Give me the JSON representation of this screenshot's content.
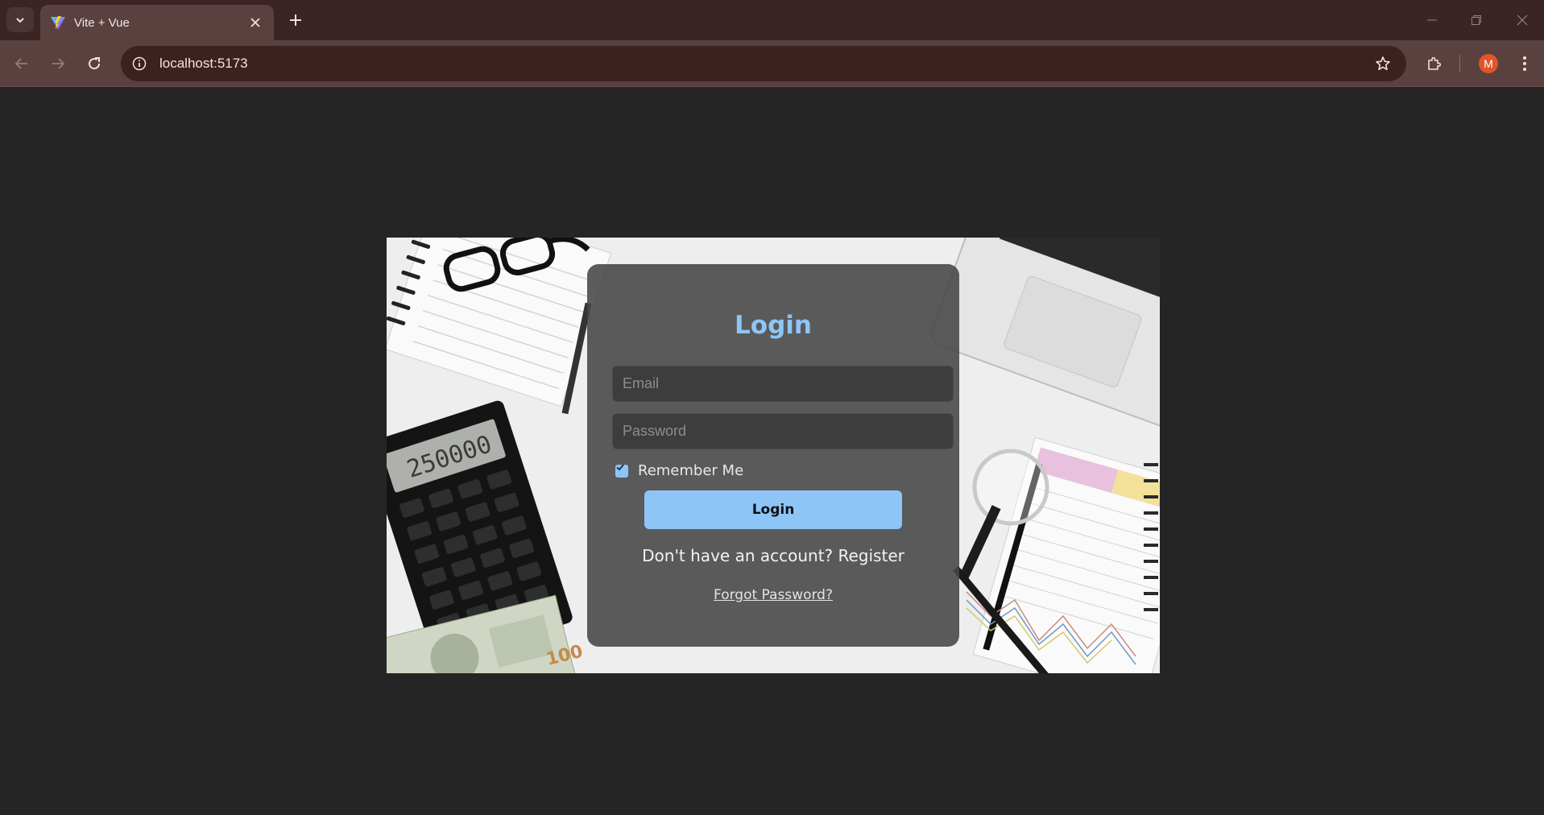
{
  "browser": {
    "tab_title": "Vite + Vue",
    "url": "localhost:5173",
    "profile_initial": "M",
    "accent_color": "#3a2524"
  },
  "login": {
    "title": "Login",
    "email_placeholder": "Email",
    "password_placeholder": "Password",
    "remember_label": "Remember Me",
    "remember_checked": true,
    "submit_label": "Login",
    "register_text": "Don't have an account? Register",
    "forgot_text": "Forgot Password?",
    "accent_color": "#8ec5f7"
  },
  "background": {
    "calculator_display": "250000"
  }
}
